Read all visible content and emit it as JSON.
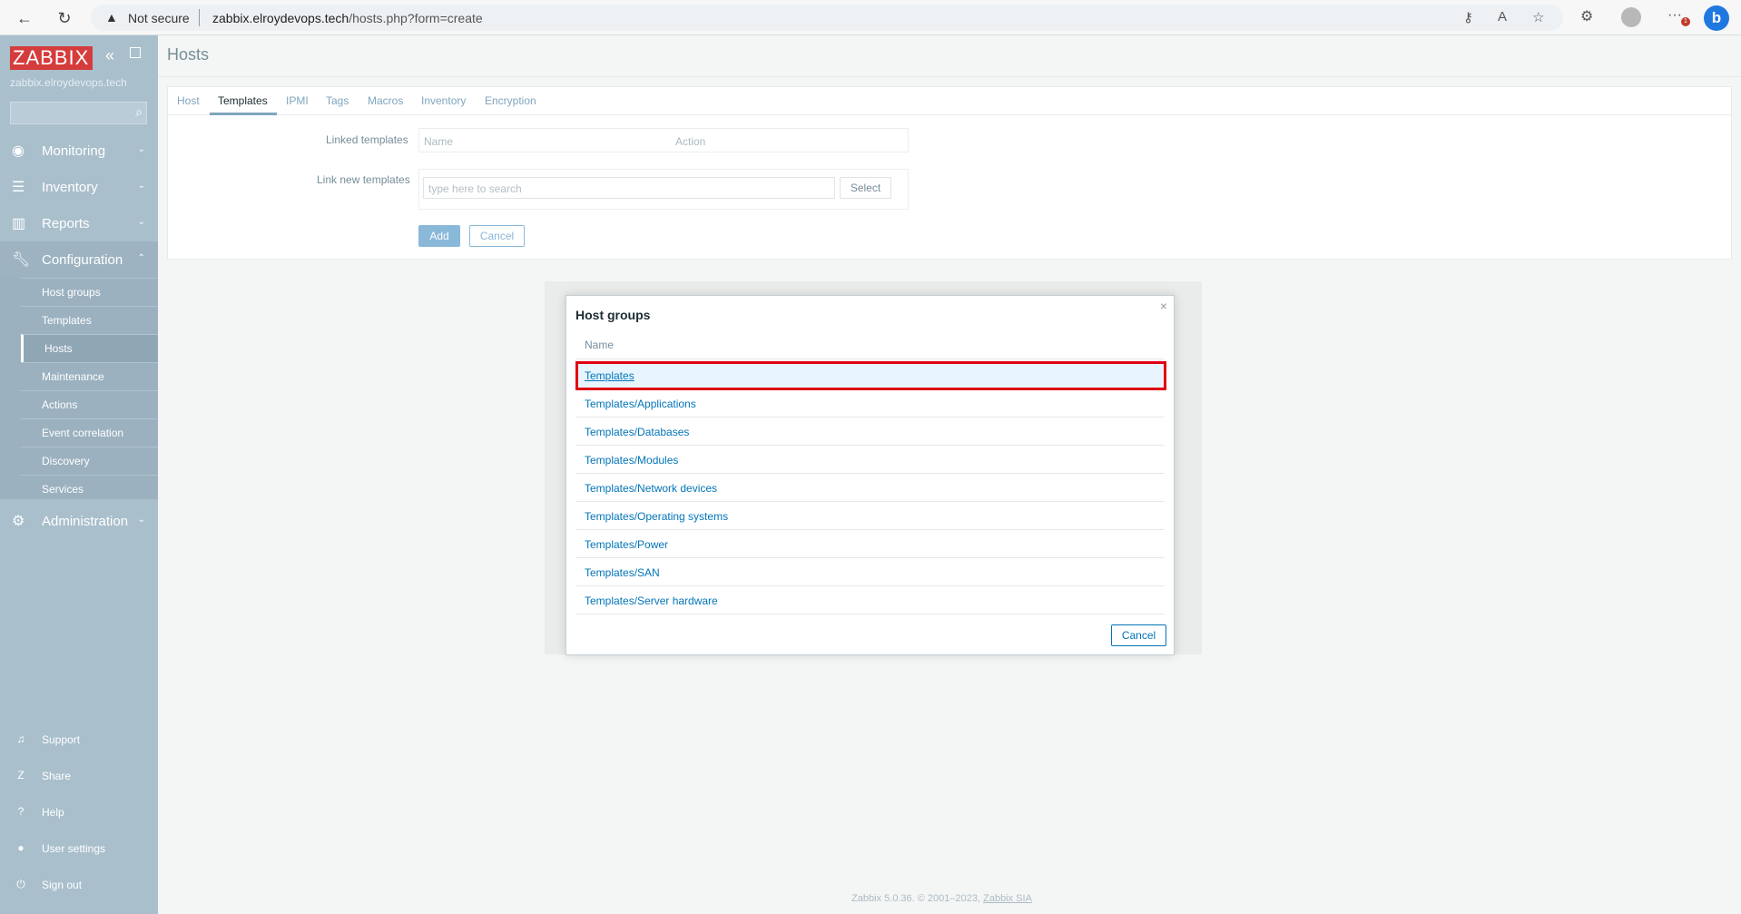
{
  "browser": {
    "security_label": "Not secure",
    "url_host": "zabbix.elroydevops.tech",
    "url_path": "/hosts.php?form=create",
    "notif_count": "1"
  },
  "sidebar": {
    "logo": "ZABBIX",
    "server_name": "zabbix.elroydevops.tech",
    "menu": [
      {
        "label": "Monitoring",
        "icon": "eye-icon"
      },
      {
        "label": "Inventory",
        "icon": "list-icon"
      },
      {
        "label": "Reports",
        "icon": "bar-chart-icon"
      },
      {
        "label": "Configuration",
        "icon": "wrench-icon"
      },
      {
        "label": "Administration",
        "icon": "gear-icon"
      }
    ],
    "config_items": [
      "Host groups",
      "Templates",
      "Hosts",
      "Maintenance",
      "Actions",
      "Event correlation",
      "Discovery",
      "Services"
    ],
    "active_config_item": "Hosts",
    "bottom": [
      {
        "label": "Support",
        "icon": "headset-icon"
      },
      {
        "label": "Share",
        "icon": "share-icon"
      },
      {
        "label": "Help",
        "icon": "help-icon"
      },
      {
        "label": "User settings",
        "icon": "user-icon"
      },
      {
        "label": "Sign out",
        "icon": "power-icon"
      }
    ]
  },
  "page": {
    "title": "Hosts",
    "tabs": [
      "Host",
      "Templates",
      "IPMI",
      "Tags",
      "Macros",
      "Inventory",
      "Encryption"
    ],
    "active_tab": "Templates",
    "linked_templates_label": "Linked templates",
    "linked_cols": [
      "Name",
      "Action"
    ],
    "link_new_label": "Link new templates",
    "search_placeholder": "type here to search",
    "select_label": "Select",
    "add_label": "Add",
    "cancel_label": "Cancel"
  },
  "modal": {
    "title": "Host groups",
    "column": "Name",
    "groups": [
      "Templates",
      "Templates/Applications",
      "Templates/Databases",
      "Templates/Modules",
      "Templates/Network devices",
      "Templates/Operating systems",
      "Templates/Power",
      "Templates/SAN",
      "Templates/Server hardware"
    ],
    "highlighted": "Templates",
    "cancel_label": "Cancel"
  },
  "footer": {
    "text": "Zabbix 5.0.36. © 2001–2023,",
    "link": "Zabbix SIA"
  }
}
